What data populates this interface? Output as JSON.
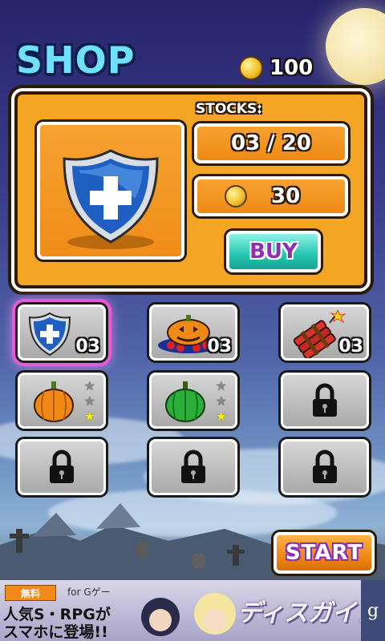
{
  "header": {
    "title": "SHOP",
    "coins": "100"
  },
  "panel": {
    "selected_item_icon": "shield-icon",
    "stocks_label": "STOCKS:",
    "stocks_value": "03 / 20",
    "price": "30",
    "buy_label": "BUY"
  },
  "inventory": [
    {
      "icon": "shield-icon",
      "count": "03",
      "selected": true
    },
    {
      "icon": "jack-o-lantern-icon",
      "count": "03"
    },
    {
      "icon": "dynamite-icon",
      "count": "03"
    },
    {
      "icon": "orange-pumpkin-icon",
      "stars": [
        false,
        false,
        true
      ]
    },
    {
      "icon": "green-pumpkin-icon",
      "stars": [
        false,
        false,
        true
      ]
    },
    {
      "icon": "lock-icon",
      "locked": true
    },
    {
      "icon": "lock-icon",
      "locked": true
    },
    {
      "icon": "lock-icon",
      "locked": true
    },
    {
      "icon": "lock-icon",
      "locked": true
    }
  ],
  "start_label": "START",
  "ad": {
    "badge": "無料",
    "for_text": "for Gゲー",
    "line1": "人気S・RPGが",
    "line2": "スマホに登場!!",
    "logo": "ディスガイア",
    "g_label": "g"
  },
  "colors": {
    "accent_orange": "#f5a524",
    "buy_teal": "#24c6b0",
    "start_orange": "#f08a16",
    "select_pink": "#e65ad8",
    "title_cyan": "#6fe0ff"
  }
}
